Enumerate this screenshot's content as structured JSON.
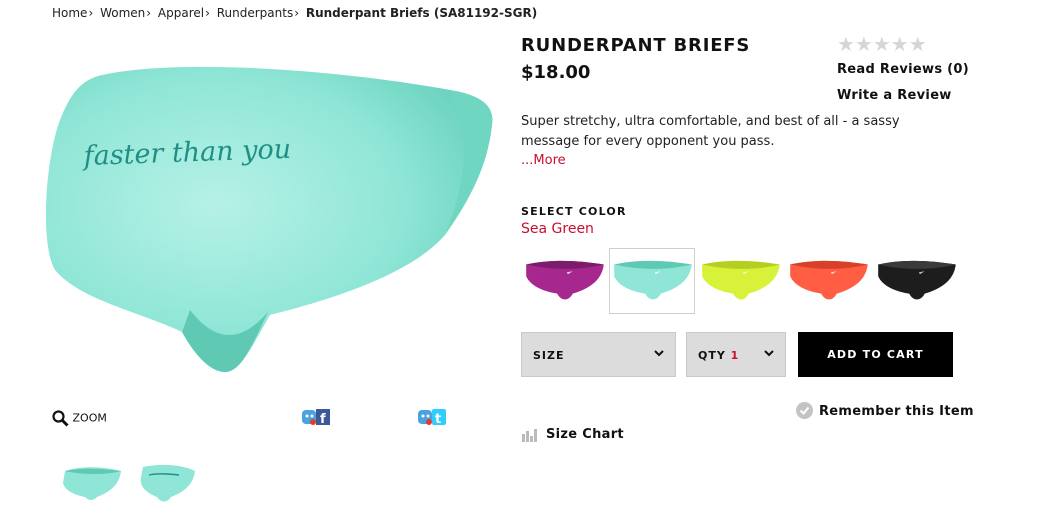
{
  "breadcrumb": {
    "items": [
      "Home",
      "Women",
      "Apparel",
      "Runderpants"
    ],
    "current": "Runderpant Briefs (SA81192-SGR)"
  },
  "product": {
    "title": "RUNDERPANT BRIEFS",
    "price": "$18.00",
    "image_text": "faster than you",
    "rating": {
      "stars_filled": 0,
      "stars_total": 5,
      "stars_glyphs": "★★★★★"
    },
    "reviews_link": "Read Reviews (0)",
    "write_review_link": "Write a Review",
    "description": "Super stretchy, ultra comfortable, and best of all - a sassy message for every opponent you pass.",
    "more_link": "...More",
    "select_color_label": "SELECT COLOR",
    "selected_color": "Sea Green",
    "swatches": [
      {
        "color": "#a6288f",
        "selected": false
      },
      {
        "color": "#7fe3cf",
        "selected": true
      },
      {
        "color": "#d8f23a",
        "selected": false
      },
      {
        "color": "#ff5e45",
        "selected": false
      },
      {
        "color": "#1d1d1d",
        "selected": false
      }
    ],
    "size_label": "SIZE",
    "qty_label": "QTY",
    "qty_value": "1",
    "add_to_cart": "ADD TO CART",
    "remember_label": "Remember this Item",
    "size_chart_label": "Size Chart"
  },
  "media": {
    "zoom_label": "ZOOM",
    "share_facebook_icon": "facebook-share-icon",
    "share_twitter_icon": "twitter-share-icon",
    "thumbnails": [
      "front-view",
      "back-view"
    ]
  },
  "colors": {
    "accent": "#c8102e",
    "product": "#8fe6d6",
    "button": "#000000"
  }
}
